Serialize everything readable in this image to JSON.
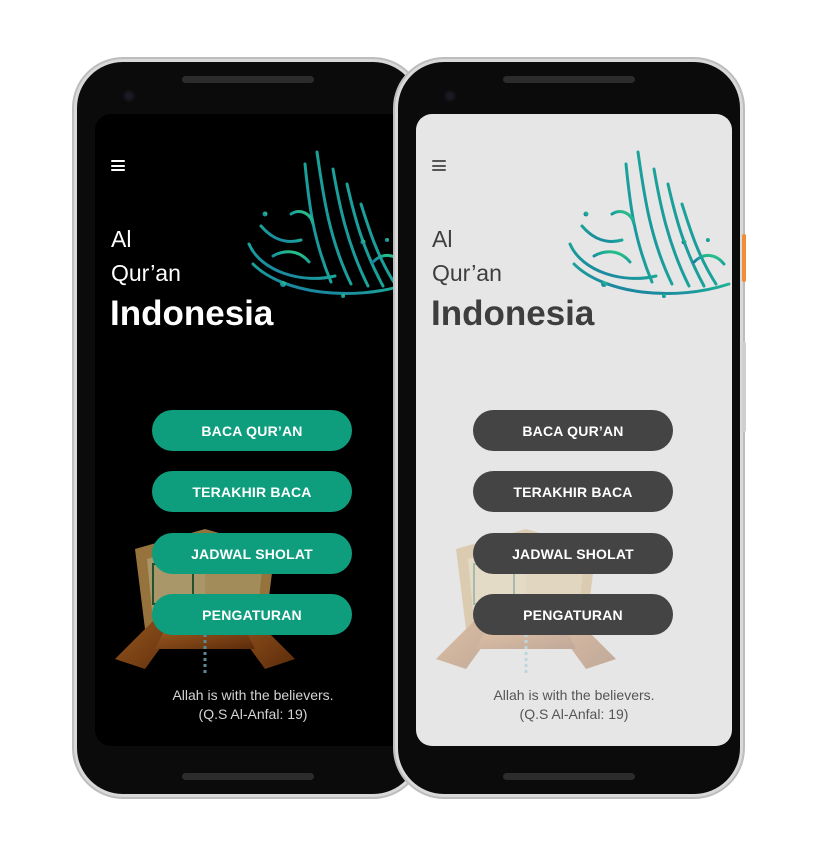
{
  "screens": [
    {
      "theme": "dark",
      "menu_icon": "hamburger-menu-icon",
      "title": {
        "line1": "Al",
        "line2": "Qur’an",
        "line3": "Indonesia"
      },
      "buttons": {
        "read": "BACA QUR’AN",
        "last_read": "TERAKHIR BACA",
        "prayer": "JADWAL SHOLAT",
        "settings": "PENGATURAN"
      },
      "quote": {
        "text": "Allah is with the believers.",
        "source": "(Q.S Al-Anfal: 19)"
      },
      "colors": {
        "background": "#000000",
        "button": "#0E9E7D",
        "text": "#FFFFFF"
      }
    },
    {
      "theme": "light",
      "menu_icon": "hamburger-menu-icon",
      "title": {
        "line1": "Al",
        "line2": "Qur’an",
        "line3": "Indonesia"
      },
      "buttons": {
        "read": "BACA QUR’AN",
        "last_read": "TERAKHIR BACA",
        "prayer": "JADWAL SHOLAT",
        "settings": "PENGATURAN"
      },
      "quote": {
        "text": "Allah is with the believers.",
        "source": "(Q.S Al-Anfal: 19)"
      },
      "colors": {
        "background": "#E6E6E6",
        "button": "#444444",
        "text": "#3E3E3E"
      }
    }
  ],
  "decorations": {
    "calligraphy": "bismillah-calligraphy",
    "background_image": "quran-on-stand"
  }
}
